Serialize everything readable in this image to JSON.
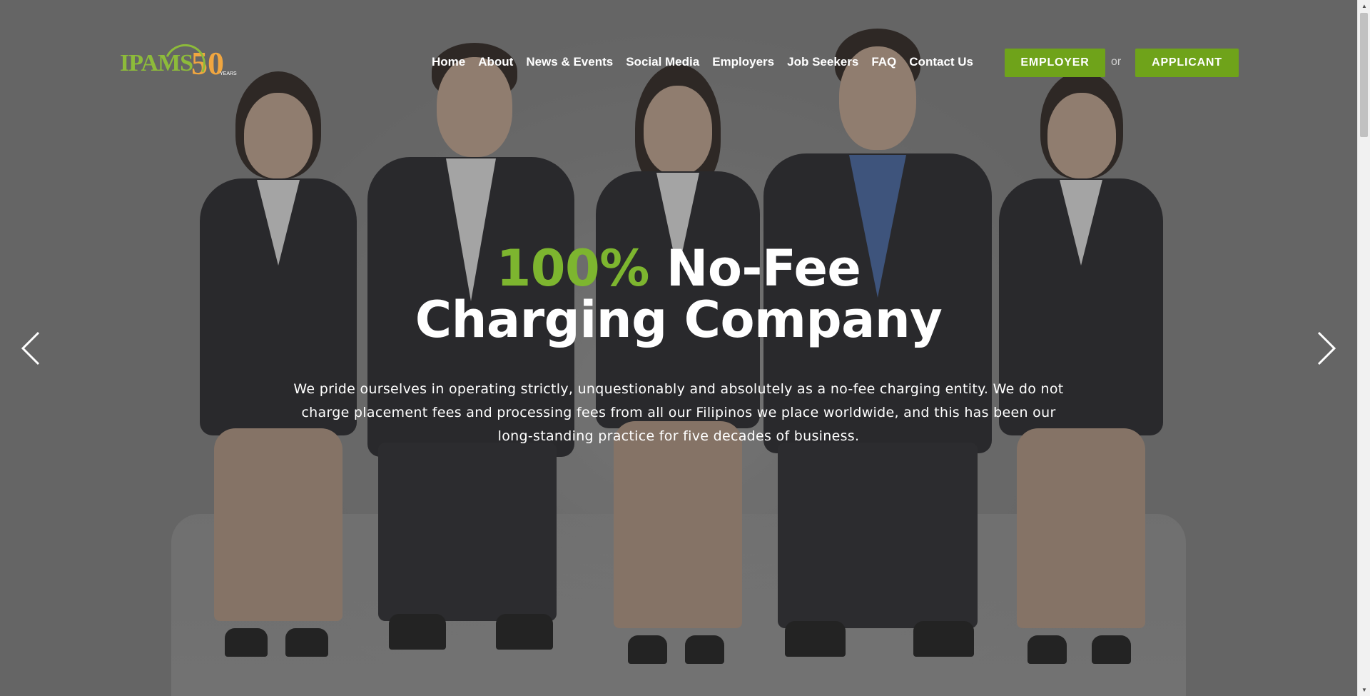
{
  "logo": {
    "text": "IPAMS",
    "number": "50",
    "years_label": "YEARS"
  },
  "nav": {
    "items": [
      "Home",
      "About",
      "News & Events",
      "Social Media",
      "Employers",
      "Job Seekers",
      "FAQ",
      "Contact Us"
    ]
  },
  "cta": {
    "employer_label": "EMPLOYER",
    "or_label": "or",
    "applicant_label": "APPLICANT"
  },
  "hero": {
    "headline_accent": "100%",
    "headline_rest": "No-Fee",
    "headline_line2": "Charging Company",
    "body": "We pride ourselves in operating strictly, unquestionably and absolutely as a no-fee charging entity. We do not charge placement fees and processing fees from all our Filipinos we place worldwide, and this has been our long-standing practice for five decades of business."
  },
  "colors": {
    "accent_green": "#6fa31a",
    "headline_green": "#7db52f",
    "logo_orange": "#f0a640"
  },
  "icons": {
    "prev": "chevron-left-icon",
    "next": "chevron-right-icon"
  }
}
